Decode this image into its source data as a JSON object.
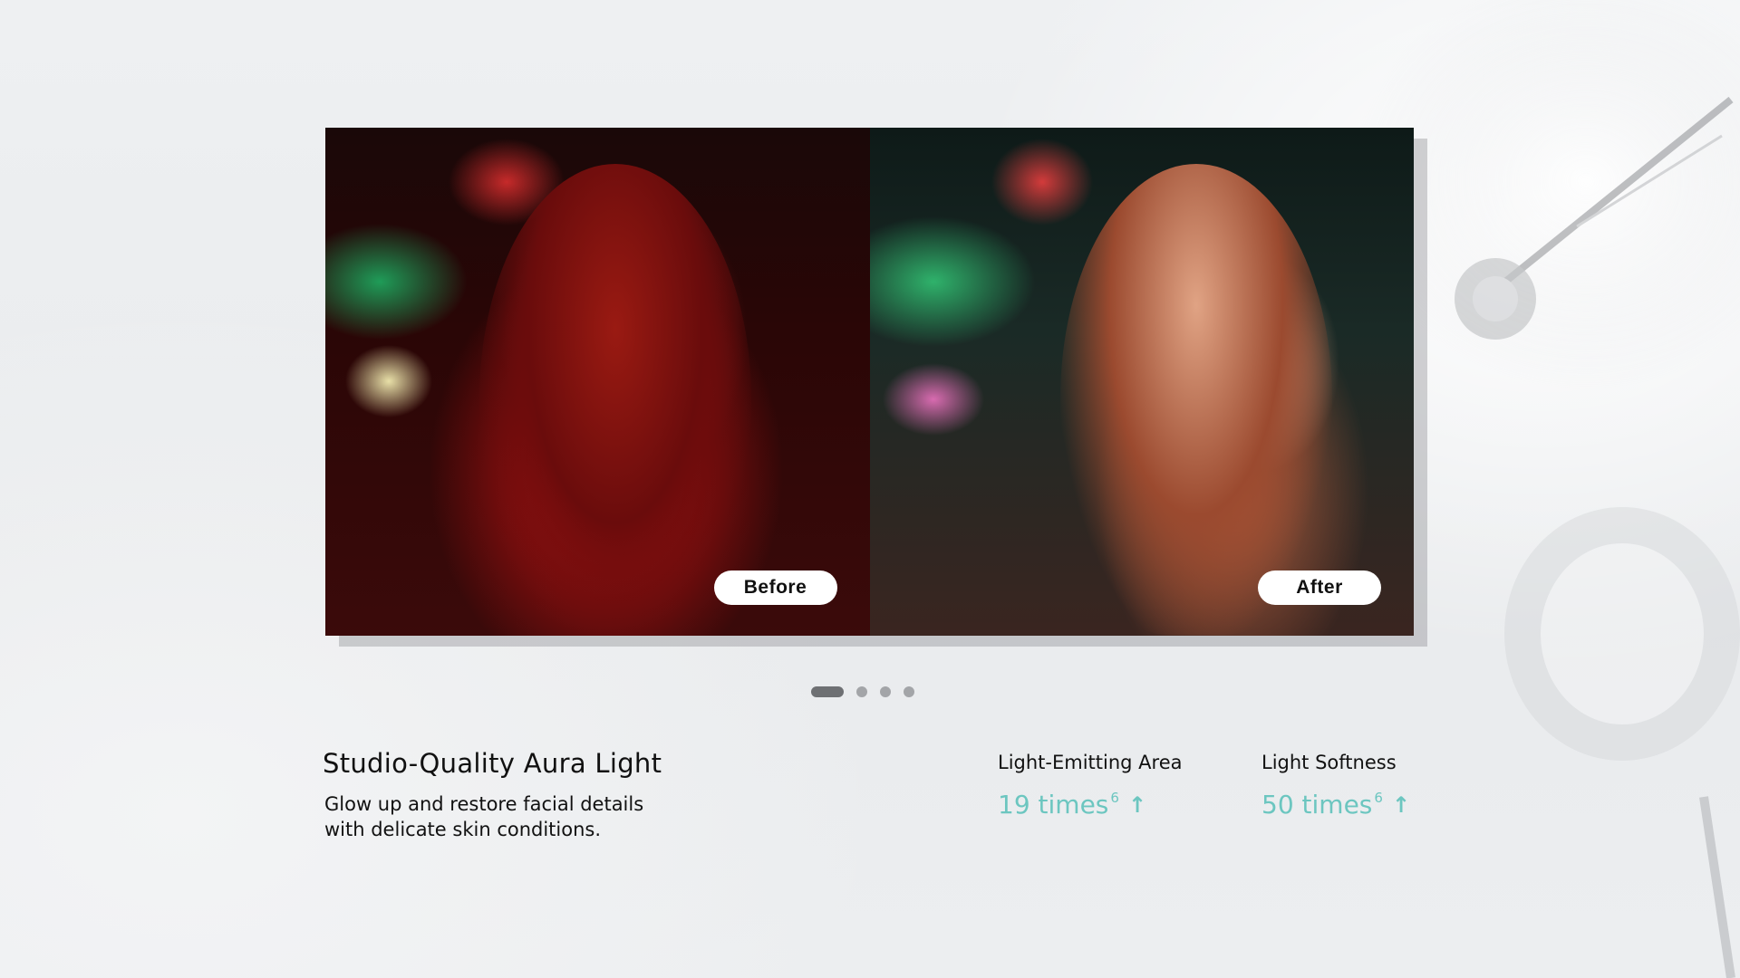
{
  "comparison": {
    "before_label": "Before",
    "after_label": "After"
  },
  "carousel": {
    "total_slides": 4,
    "active_slide": 1
  },
  "feature": {
    "title": "Studio-Quality Aura Light",
    "description_line1": "Glow up and restore facial details",
    "description_line2": "with delicate skin conditions."
  },
  "stats": [
    {
      "label": "Light-Emitting Area",
      "value": "19 times",
      "footnote": "6",
      "trend_icon": "arrow-up-icon"
    },
    {
      "label": "Light Softness",
      "value": "50 times",
      "footnote": "6",
      "trend_icon": "arrow-up-icon"
    }
  ],
  "colors": {
    "accent": "#6cc6c0",
    "text": "#111111",
    "dot_active": "#6e7073",
    "dot_inactive": "#a3a5a8"
  }
}
